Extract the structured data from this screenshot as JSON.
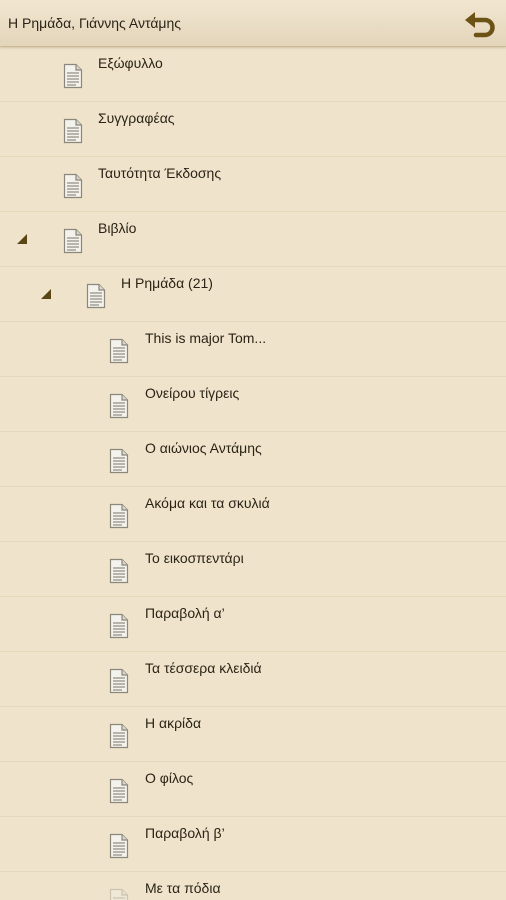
{
  "header": {
    "title": "Η Ρημάδα, Γιάννης Αντάμης",
    "back_icon": "back-arrow-icon"
  },
  "colors": {
    "background": "#efe3cb",
    "accent": "#6b5316"
  },
  "toc": {
    "items": [
      {
        "label": "Εξώφυλλο",
        "level": 0,
        "expandable": false
      },
      {
        "label": "Συγγραφέας",
        "level": 0,
        "expandable": false
      },
      {
        "label": "Ταυτότητα Έκδοσης",
        "level": 0,
        "expandable": false
      },
      {
        "label": "Βιβλίο",
        "level": 0,
        "expandable": true,
        "expanded": true
      },
      {
        "label": "Η Ρημάδα (21)",
        "level": 1,
        "expandable": true,
        "expanded": true
      },
      {
        "label": "This is major Tom...",
        "level": 2,
        "expandable": false
      },
      {
        "label": "Ονείρου τίγρεις",
        "level": 2,
        "expandable": false
      },
      {
        "label": "Ο αιώνιος Αντάμης",
        "level": 2,
        "expandable": false
      },
      {
        "label": "Ακόμα και τα σκυλιά",
        "level": 2,
        "expandable": false
      },
      {
        "label": "Το εικοσπεντάρι",
        "level": 2,
        "expandable": false
      },
      {
        "label": "Παραβολή α’",
        "level": 2,
        "expandable": false
      },
      {
        "label": "Τα τέσσερα κλειδιά",
        "level": 2,
        "expandable": false
      },
      {
        "label": "Η ακρίδα",
        "level": 2,
        "expandable": false
      },
      {
        "label": "Ο φίλος",
        "level": 2,
        "expandable": false
      },
      {
        "label": "Παραβολή β’",
        "level": 2,
        "expandable": false
      },
      {
        "label": "Με τα πόδια",
        "level": 2,
        "expandable": false,
        "partial": true
      }
    ]
  }
}
